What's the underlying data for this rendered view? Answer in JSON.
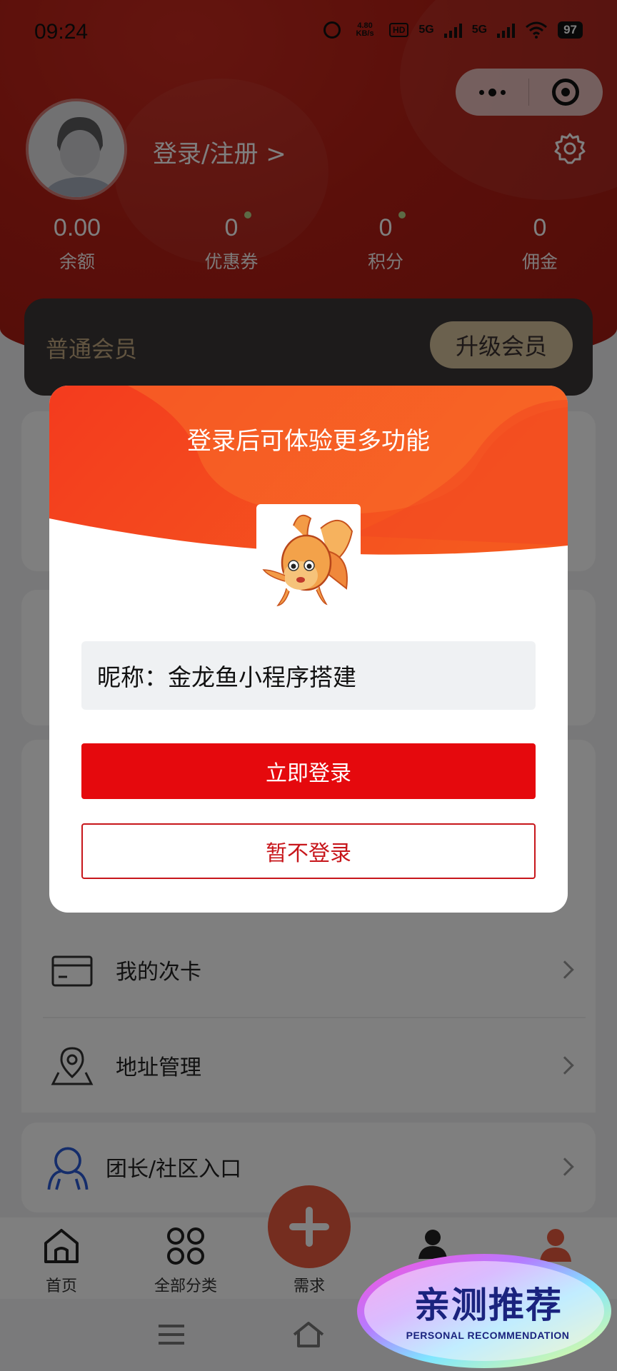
{
  "status_bar": {
    "time": "09:24",
    "net_speed": "4.80\nKB/s",
    "hd": "HD",
    "sim1": "1",
    "sim2": "2",
    "net1": "5G",
    "net2": "5G",
    "battery": "97"
  },
  "profile": {
    "login_link": "登录/注册 >"
  },
  "stats": [
    {
      "value": "0.00",
      "label": "余额"
    },
    {
      "value": "0",
      "label": "优惠券"
    },
    {
      "value": "0",
      "label": "积分"
    },
    {
      "value": "0",
      "label": "佣金"
    }
  ],
  "member": {
    "level": "普通会员",
    "upgrade": "升级会员"
  },
  "menu": [
    {
      "label": "我的次卡",
      "icon": "card-icon"
    },
    {
      "label": "地址管理",
      "icon": "location-icon"
    },
    {
      "label": "团长/社区入口",
      "icon": "community-icon"
    }
  ],
  "bottom_nav": [
    {
      "label": "首页",
      "icon": "home-icon"
    },
    {
      "label": "全部分类",
      "icon": "categories-icon"
    },
    {
      "label": "需求",
      "icon": "plus-icon"
    },
    {
      "label": "",
      "icon": "team-icon"
    },
    {
      "label": "",
      "icon": "user-icon"
    }
  ],
  "modal": {
    "title": "登录后可体验更多功能",
    "nickname": "昵称：金龙鱼小程序搭建",
    "login_button": "立即登录",
    "skip_button": "暂不登录"
  },
  "badge": {
    "title": "亲测推荐",
    "subtitle": "PERSONAL RECOMMENDATION"
  },
  "colors": {
    "brand_red": "#e5090d",
    "header_red": "#b51e14",
    "fab_orange": "#ea5a3e",
    "gold": "#d7c39c"
  }
}
